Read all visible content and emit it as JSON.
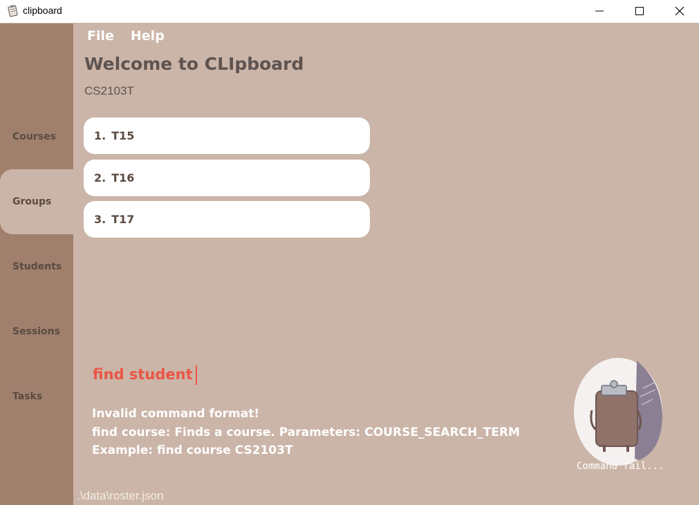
{
  "window": {
    "title": "clipboard",
    "minimize_icon": "minimize-icon",
    "maximize_icon": "maximize-icon",
    "close_icon": "close-icon"
  },
  "menu": {
    "file": "File",
    "help": "Help"
  },
  "sidebar": {
    "items": [
      {
        "label": "Courses",
        "active": false
      },
      {
        "label": "Groups",
        "active": true
      },
      {
        "label": "Students",
        "active": false
      },
      {
        "label": "Sessions",
        "active": false
      },
      {
        "label": "Tasks",
        "active": false
      }
    ]
  },
  "header": {
    "title": "Welcome to CLIpboard",
    "subtitle": "CS2103T"
  },
  "groups": [
    {
      "index": "1.",
      "name": "T15"
    },
    {
      "index": "2.",
      "name": "T16"
    },
    {
      "index": "3.",
      "name": "T17"
    }
  ],
  "command": {
    "value": "find student"
  },
  "result": {
    "lines": [
      "Invalid command format!",
      "find course: Finds a course. Parameters: COURSE_SEARCH_TERM",
      "Example: find course CS2103T"
    ]
  },
  "mascot": {
    "caption": "Command fail..."
  },
  "status": {
    "file_path": ".\\data\\roster.json"
  },
  "colors": {
    "background": "#cbb5a8",
    "sidebar": "#a0806d",
    "error_text": "#ea5545",
    "card": "#ffffff"
  }
}
